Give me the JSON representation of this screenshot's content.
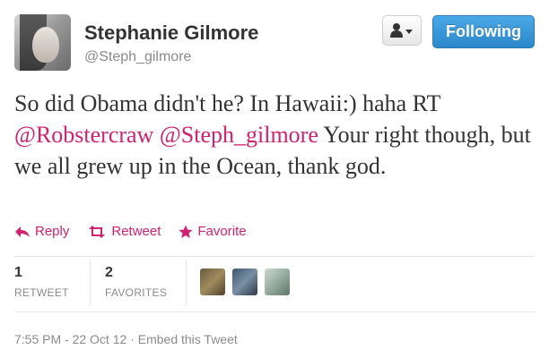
{
  "user": {
    "name": "Stephanie Gilmore",
    "handle": "@Steph_gilmore"
  },
  "buttons": {
    "follow_label": "Following",
    "user_actions_icon": "user-icon"
  },
  "tweet": {
    "text_part1": "So did Obama didn't he? In Hawaii:) haha RT ",
    "mention1": "@Robstercraw",
    "space": " ",
    "mention2": "@Steph_gilmore",
    "text_part2": " Your right though, but we all grew up in the Ocean, thank god."
  },
  "actions": {
    "reply": "Reply",
    "retweet": "Retweet",
    "favorite": "Favorite"
  },
  "stats": {
    "retweets_count": "1",
    "retweets_label": "RETWEET",
    "favorites_count": "2",
    "favorites_label": "FAVORITES"
  },
  "meta": {
    "timestamp": "7:55 PM - 22 Oct 12",
    "separator": "·",
    "embed": "Embed this Tweet"
  },
  "colors": {
    "accent": "#d0226f",
    "follow_button": "#2c87c9"
  }
}
